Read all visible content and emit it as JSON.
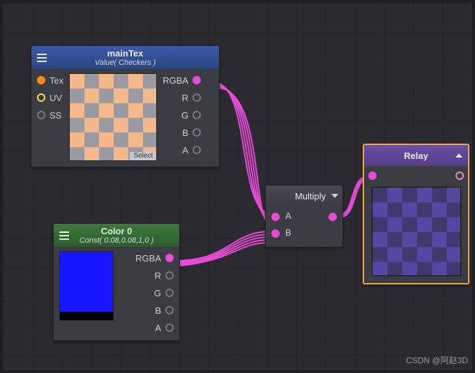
{
  "nodes": {
    "mainTex": {
      "title": "mainTex",
      "subtitle": "Value( Checkers )",
      "inputs": [
        "Tex",
        "UV",
        "SS"
      ],
      "outputs": [
        "RGBA",
        "R",
        "G",
        "B",
        "A"
      ],
      "select_label": "Select"
    },
    "color0": {
      "title": "Color 0",
      "subtitle": "Const( 0.08,0.08,1,0 )",
      "outputs": [
        "RGBA",
        "R",
        "G",
        "B",
        "A"
      ],
      "swatch_color": "#1616ff"
    },
    "multiply": {
      "title": "Multiply",
      "inputs": [
        "A",
        "B"
      ]
    },
    "relay": {
      "title": "Relay"
    }
  },
  "watermark": "CSDN @阿赵3D"
}
